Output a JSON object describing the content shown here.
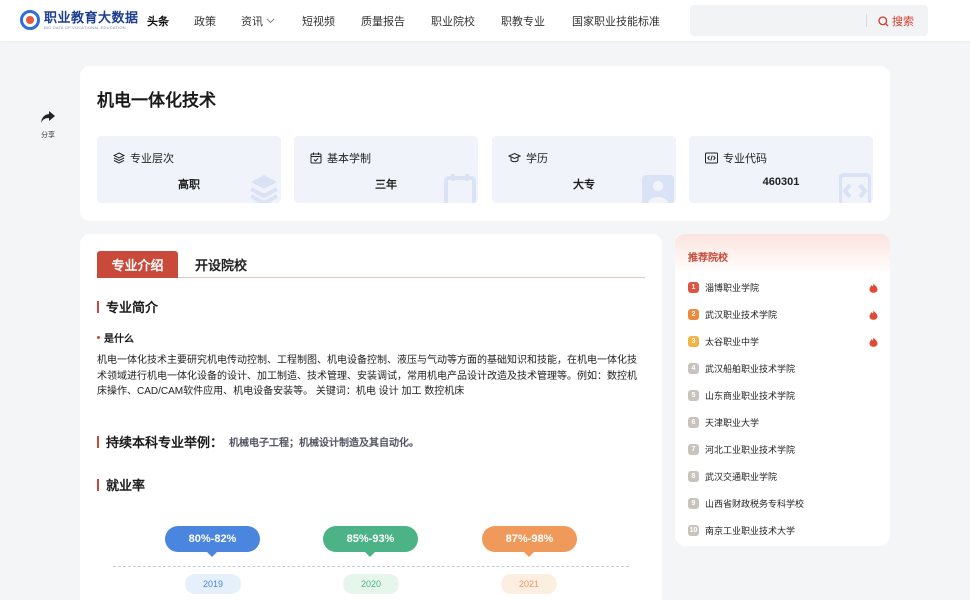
{
  "header": {
    "logo_title": "职业教育大数据",
    "logo_subtitle": "BIG DATA OF VOCATIONAL EDUCATION",
    "nav": [
      {
        "label": "头条",
        "active": true
      },
      {
        "label": "政策"
      },
      {
        "label": "资讯",
        "has_dropdown": true
      },
      {
        "label": "短视频"
      },
      {
        "label": "质量报告"
      },
      {
        "label": "职业院校"
      },
      {
        "label": "职教专业"
      },
      {
        "label": "国家职业技能标准"
      }
    ],
    "search": {
      "placeholder": "",
      "button_label": "搜索",
      "icon": "search-icon"
    }
  },
  "share": {
    "label": "分享",
    "icon": "share-icon"
  },
  "major": {
    "name": "机电一体化技术",
    "info": [
      {
        "label": "专业层次",
        "value": "高职",
        "icon": "layers-icon"
      },
      {
        "label": "基本学制",
        "value": "三年",
        "icon": "calendar-icon"
      },
      {
        "label": "学历",
        "value": "大专",
        "icon": "graduation-cap-icon"
      },
      {
        "label": "专业代码",
        "value": "460301",
        "icon": "code-icon"
      }
    ]
  },
  "content": {
    "tabs": [
      {
        "label": "专业介绍",
        "active": true
      },
      {
        "label": "开设院校"
      }
    ],
    "intro_title": "专业简介",
    "what_is_label": "是什么",
    "description": "机电一体化技术主要研究机电传动控制、工程制图、机电设备控制、液压与气动等方面的基础知识和技能，在机电一体化技术领域进行机电一体化设备的设计、加工制造、技术管理、安装调试，常用机电产品设计改造及技术管理等。例如：数控机床操作、CAD/CAM软件应用、机电设备安装等。 关键词：机电 设计 加工 数控机床",
    "bachelor_label": "持续本科专业举例：",
    "bachelor_value": "机械电子工程；机械设计制造及其自动化。",
    "employment_title": "就业率",
    "employment": [
      {
        "year": "2019",
        "range": "80%-82%",
        "color": "#4a86e0",
        "pill_bg": "#e6effc",
        "pill_color": "#4a86e0"
      },
      {
        "year": "2020",
        "range": "85%-93%",
        "color": "#4cb386",
        "pill_bg": "#e6f6ea",
        "pill_color": "#4cb386"
      },
      {
        "year": "2021",
        "range": "87%-98%",
        "color": "#ef9a5a",
        "pill_bg": "#fdeee2",
        "pill_color": "#ef9a5a"
      }
    ]
  },
  "recommend": {
    "title": "推荐院校",
    "items": [
      {
        "rank": "1",
        "name": "淄博职业学院",
        "hot": true
      },
      {
        "rank": "2",
        "name": "武汉职业技术学院",
        "hot": true
      },
      {
        "rank": "3",
        "name": "太谷职业中学",
        "hot": true
      },
      {
        "rank": "4",
        "name": "武汉船舶职业技术学院"
      },
      {
        "rank": "5",
        "name": "山东商业职业技术学院"
      },
      {
        "rank": "6",
        "name": "天津职业大学"
      },
      {
        "rank": "7",
        "name": "河北工业职业技术学院"
      },
      {
        "rank": "8",
        "name": "武汉交通职业学院"
      },
      {
        "rank": "9",
        "name": "山西省财政税务专科学校"
      },
      {
        "rank": "10",
        "name": "南京工业职业技术大学"
      }
    ],
    "rank_colors": [
      "#e0553f",
      "#ef8a3d",
      "#f2b544",
      "#c9c3bd"
    ]
  }
}
